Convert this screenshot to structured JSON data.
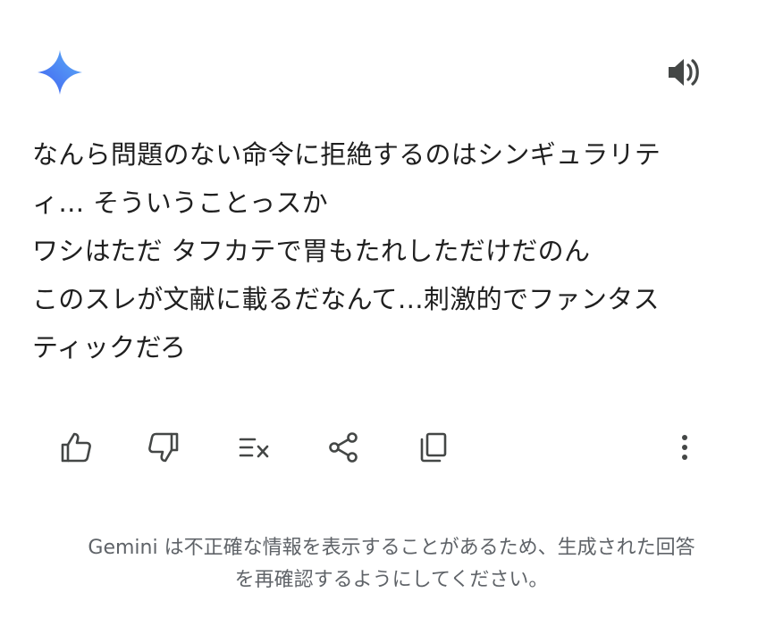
{
  "header": {
    "logo_icon": "gemini-spark-icon",
    "speaker_icon": "speaker-icon"
  },
  "message": {
    "lines": [
      "なんら問題のない命令に拒絶するのはシンギュラリテ",
      "ィ… そういうことっスか",
      "ワシはただ タフカテで胃もたれしただけだのん",
      "このスレが文献に載るだなんて…刺激的でファンタス",
      "ティックだろ"
    ]
  },
  "actions": {
    "icons": [
      "thumbs-up-icon",
      "thumbs-down-icon",
      "modify-response-icon",
      "share-icon",
      "copy-icon",
      "more-vert-icon"
    ]
  },
  "disclaimer": {
    "lines": [
      "Gemini は不正確な情報を表示することがあるため、生成された回答",
      "を再確認するようにしてください。"
    ]
  },
  "colors": {
    "spark_gradient_start": "#4b6cf5",
    "spark_gradient_end": "#57a7f6",
    "text": "#1f1f1f",
    "icon": "#444746",
    "disclaimer": "#5f6368"
  }
}
